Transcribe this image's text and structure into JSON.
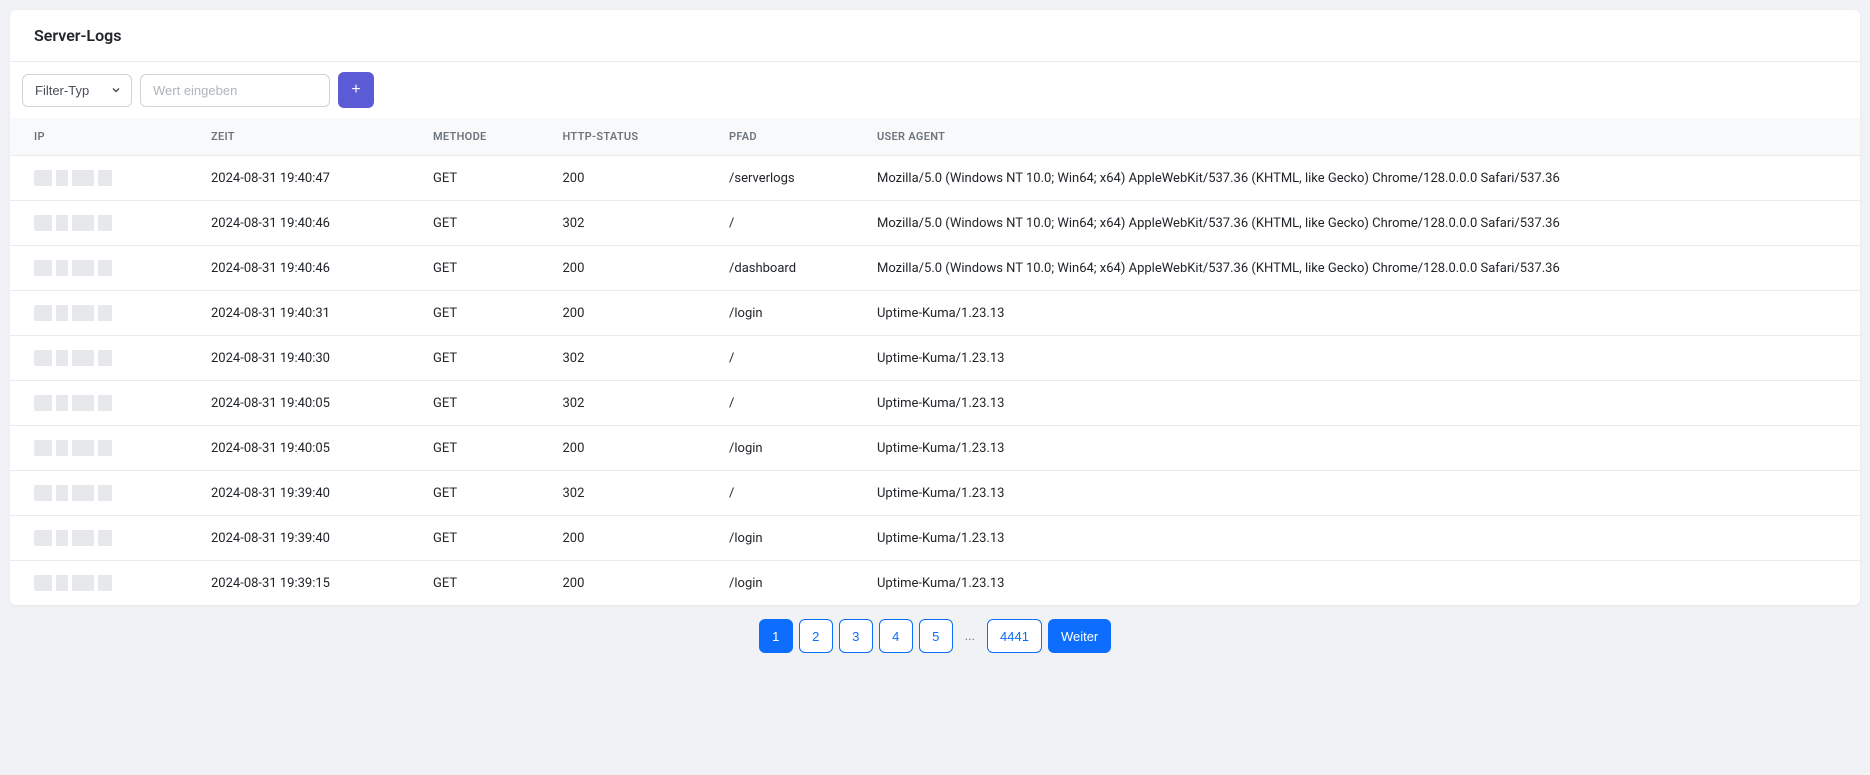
{
  "header": {
    "title": "Server-Logs"
  },
  "filter": {
    "type_label": "Filter-Typ",
    "input_placeholder": "Wert eingeben",
    "add_label": "+"
  },
  "columns": {
    "ip": "IP",
    "zeit": "ZEIT",
    "methode": "METHODE",
    "status": "HTTP-STATUS",
    "pfad": "PFAD",
    "ua": "USER AGENT"
  },
  "rows": [
    {
      "zeit": "2024-08-31 19:40:47",
      "method": "GET",
      "status": "200",
      "pfad": "/serverlogs",
      "ua": "Mozilla/5.0 (Windows NT 10.0; Win64; x64) AppleWebKit/537.36 (KHTML, like Gecko) Chrome/128.0.0.0 Safari/537.36"
    },
    {
      "zeit": "2024-08-31 19:40:46",
      "method": "GET",
      "status": "302",
      "pfad": "/",
      "ua": "Mozilla/5.0 (Windows NT 10.0; Win64; x64) AppleWebKit/537.36 (KHTML, like Gecko) Chrome/128.0.0.0 Safari/537.36"
    },
    {
      "zeit": "2024-08-31 19:40:46",
      "method": "GET",
      "status": "200",
      "pfad": "/dashboard",
      "ua": "Mozilla/5.0 (Windows NT 10.0; Win64; x64) AppleWebKit/537.36 (KHTML, like Gecko) Chrome/128.0.0.0 Safari/537.36"
    },
    {
      "zeit": "2024-08-31 19:40:31",
      "method": "GET",
      "status": "200",
      "pfad": "/login",
      "ua": "Uptime-Kuma/1.23.13"
    },
    {
      "zeit": "2024-08-31 19:40:30",
      "method": "GET",
      "status": "302",
      "pfad": "/",
      "ua": "Uptime-Kuma/1.23.13"
    },
    {
      "zeit": "2024-08-31 19:40:05",
      "method": "GET",
      "status": "302",
      "pfad": "/",
      "ua": "Uptime-Kuma/1.23.13"
    },
    {
      "zeit": "2024-08-31 19:40:05",
      "method": "GET",
      "status": "200",
      "pfad": "/login",
      "ua": "Uptime-Kuma/1.23.13"
    },
    {
      "zeit": "2024-08-31 19:39:40",
      "method": "GET",
      "status": "302",
      "pfad": "/",
      "ua": "Uptime-Kuma/1.23.13"
    },
    {
      "zeit": "2024-08-31 19:39:40",
      "method": "GET",
      "status": "200",
      "pfad": "/login",
      "ua": "Uptime-Kuma/1.23.13"
    },
    {
      "zeit": "2024-08-31 19:39:15",
      "method": "GET",
      "status": "200",
      "pfad": "/login",
      "ua": "Uptime-Kuma/1.23.13"
    }
  ],
  "pagination": {
    "pages": [
      "1",
      "2",
      "3",
      "4",
      "5"
    ],
    "ellipsis": "...",
    "last": "4441",
    "next": "Weiter",
    "active": "1"
  }
}
